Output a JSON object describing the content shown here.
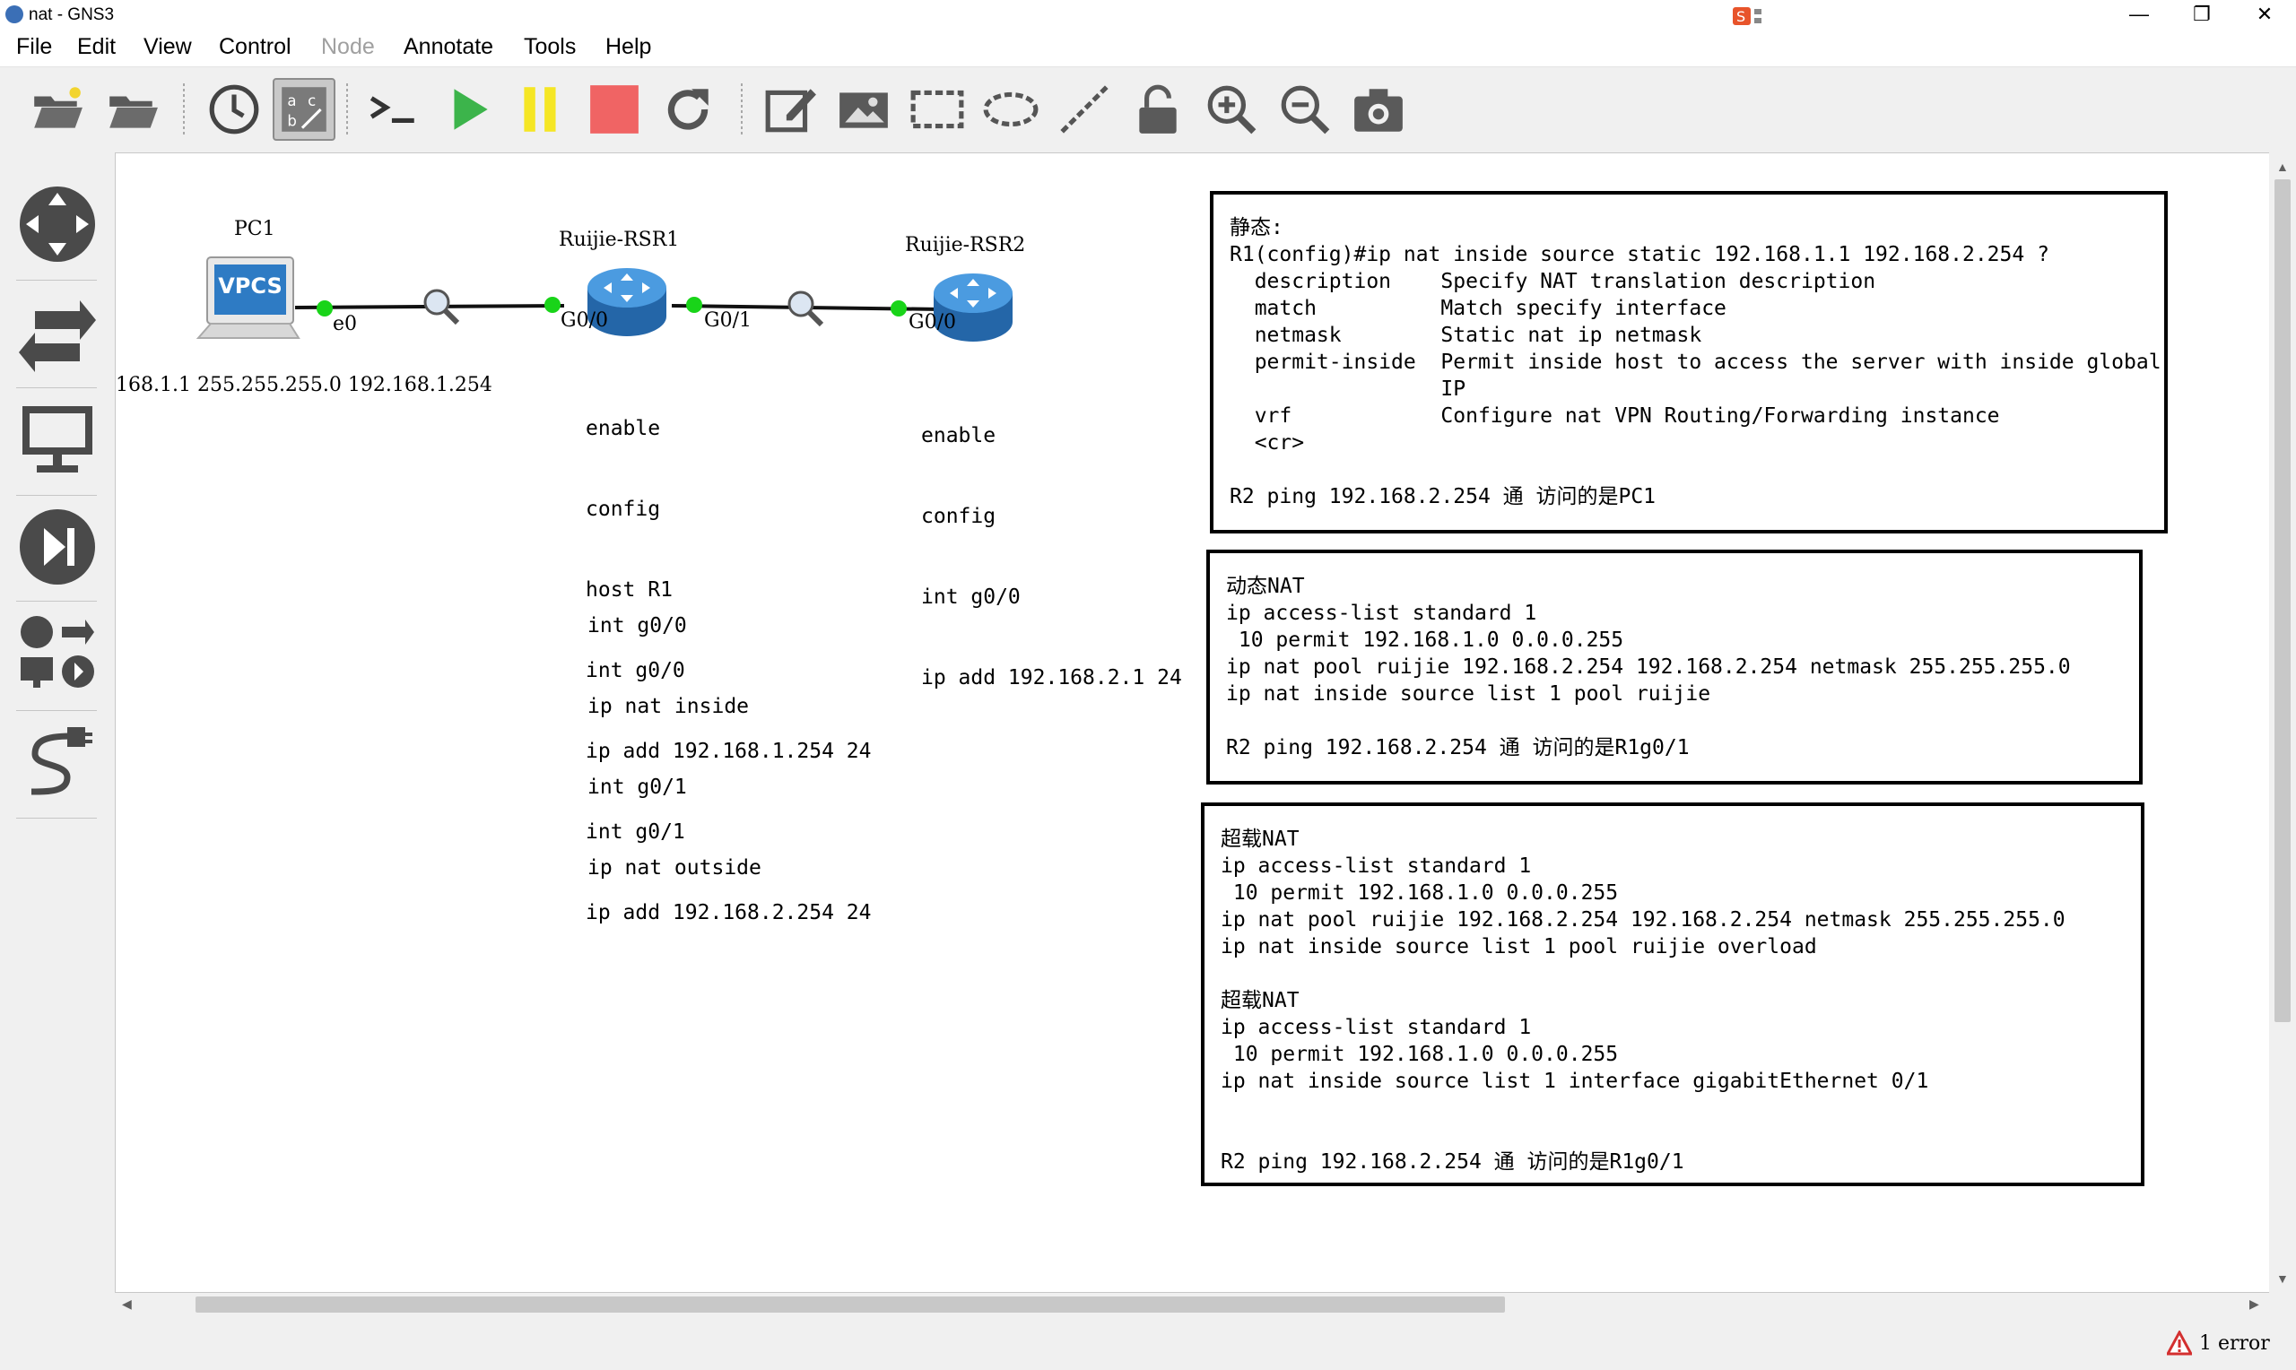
{
  "window": {
    "title": "nat - GNS3",
    "minimize": "—",
    "restore": "❐",
    "close": "✕"
  },
  "menu": [
    "File",
    "Edit",
    "View",
    "Control",
    "Node",
    "Annotate",
    "Tools",
    "Help"
  ],
  "toolbar": {
    "icons": [
      "open-folder-icon",
      "open-project-icon",
      "snapshot-clock-icon",
      "interface-labels-icon",
      "console-icon",
      "start-icon",
      "suspend-icon",
      "stop-icon",
      "reload-icon",
      "add-note-icon",
      "insert-picture-icon",
      "draw-rectangle-icon",
      "draw-ellipse-icon",
      "draw-line-icon",
      "lock-icon",
      "zoom-in-icon",
      "zoom-out-icon",
      "screenshot-icon"
    ]
  },
  "sidebar": {
    "icons": [
      "routers-icon",
      "switches-icon",
      "end-devices-icon",
      "security-devices-icon",
      "all-devices-icon",
      "add-link-icon"
    ]
  },
  "topology": {
    "nodes": {
      "pc1": {
        "name": "PC1",
        "badge": "VPCS",
        "ip": "168.1.1 255.255.255.0 192.168.1.254"
      },
      "rsr1": {
        "name": "Ruijie-RSR1"
      },
      "rsr2": {
        "name": "Ruijie-RSR2"
      }
    },
    "ports": {
      "pc1_e0": "e0",
      "rsr1_g00": "G0/0",
      "rsr1_g01": "G0/1",
      "rsr2_g00": "G0/0"
    },
    "r1_config": [
      "enable",
      "config",
      "host R1",
      "int g0/0",
      "ip add 192.168.1.254 24",
      "int g0/1",
      "ip add 192.168.2.254 24"
    ],
    "r1_nat_config": [
      "int g0/0",
      "ip nat inside",
      "int g0/1",
      "ip nat outside"
    ],
    "r2_config": [
      "enable",
      "config",
      "int g0/0",
      "ip add 192.168.2.1 24"
    ]
  },
  "notes": {
    "static": [
      "静态:",
      "R1(config)#ip nat inside source static 192.168.1.1 192.168.2.254 ?",
      "  description    Specify NAT translation description",
      "  match          Match specify interface",
      "  netmask        Static nat ip netmask",
      "  permit-inside  Permit inside host to access the server with inside global",
      "                 IP",
      "  vrf            Configure nat VPN Routing/Forwarding instance",
      "  <cr>",
      "",
      "R2 ping 192.168.2.254 通 访问的是PC1"
    ],
    "dynamic": [
      "动态NAT",
      "ip access-list standard 1",
      " 10 permit 192.168.1.0 0.0.0.255",
      "ip nat pool ruijie 192.168.2.254 192.168.2.254 netmask 255.255.255.0",
      "ip nat inside source list 1 pool ruijie",
      "",
      "R2 ping 192.168.2.254 通 访问的是R1g0/1"
    ],
    "overload": [
      "超载NAT",
      "ip access-list standard 1",
      " 10 permit 192.168.1.0 0.0.0.255",
      "ip nat pool ruijie 192.168.2.254 192.168.2.254 netmask 255.255.255.0",
      "ip nat inside source list 1 pool ruijie overload",
      "",
      "超载NAT",
      "ip access-list standard 1",
      " 10 permit 192.168.1.0 0.0.0.255",
      "ip nat inside source list 1 interface gigabitEthernet 0/1",
      "",
      "",
      "R2 ping 192.168.2.254 通 访问的是R1g0/1"
    ]
  },
  "status": {
    "errors": "1 error"
  },
  "colors": {
    "link_up": "#19d419",
    "start": "#3cb44b",
    "suspend": "#f5e625",
    "stop": "#f06464",
    "router": "#2d7fc1"
  }
}
